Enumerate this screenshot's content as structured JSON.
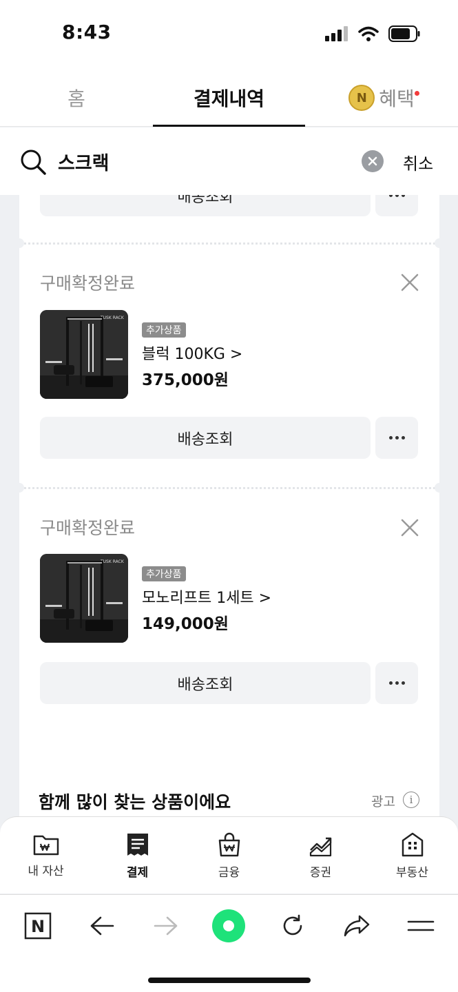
{
  "status": {
    "time": "8:43"
  },
  "tabs": [
    {
      "label": "홈"
    },
    {
      "label": "결제내역"
    },
    {
      "label": "혜택",
      "coin": "N"
    }
  ],
  "search": {
    "query": "스크랙",
    "cancel": "취소"
  },
  "orders": {
    "partial_button": "배송조회",
    "items": [
      {
        "status": "구매확정완료",
        "badge": "추가상품",
        "name": "블럭 100KG >",
        "price": "375,000원",
        "track": "배송조회"
      },
      {
        "status": "구매확정완료",
        "badge": "추가상품",
        "name": "모노리프트 1세트 >",
        "price": "149,000원",
        "track": "배송조회"
      }
    ]
  },
  "recommend": {
    "title": "함께 많이 찾는 상품이에요",
    "ad": "광고",
    "info": "i"
  },
  "bottom_nav": [
    {
      "label": "내 자산",
      "icon": "wallet-won-icon"
    },
    {
      "label": "결제",
      "icon": "receipt-icon"
    },
    {
      "label": "금융",
      "icon": "bag-won-icon"
    },
    {
      "label": "증권",
      "icon": "chart-trend-icon"
    },
    {
      "label": "부동산",
      "icon": "building-icon"
    }
  ],
  "browser": {
    "logo": "N",
    "icons": [
      "naver-logo-icon",
      "back-arrow-icon",
      "forward-arrow-icon",
      "green-dot-icon",
      "refresh-icon",
      "share-icon",
      "menu-icon"
    ],
    "accent": "#1ee27a"
  },
  "colors": {
    "badge": "#8c8c8c",
    "red_dot": "#f23c3c",
    "coin": "#e6c24a"
  }
}
